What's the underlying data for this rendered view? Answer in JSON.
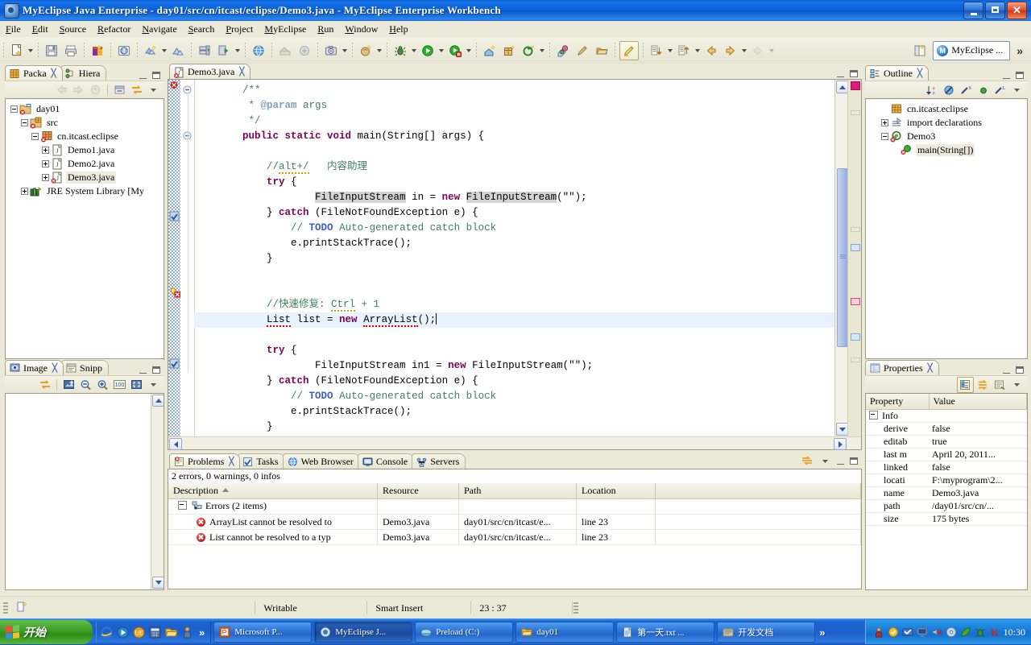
{
  "window": {
    "title": "MyEclipse Java Enterprise - day01/src/cn/itcast/eclipse/Demo3.java - MyEclipse Enterprise Workbench",
    "minimize_label": "Minimize",
    "maximize_label": "Maximize",
    "close_label": "Close"
  },
  "menubar": {
    "items": [
      {
        "label": "File"
      },
      {
        "label": "Edit"
      },
      {
        "label": "Source"
      },
      {
        "label": "Refactor"
      },
      {
        "label": "Navigate"
      },
      {
        "label": "Search"
      },
      {
        "label": "Project"
      },
      {
        "label": "MyEclipse"
      },
      {
        "label": "Run"
      },
      {
        "label": "Window"
      },
      {
        "label": "Help"
      }
    ]
  },
  "toolbar": {
    "perspective_label": "MyEclipse ...",
    "perspective_badge": "M",
    "overflow_label": "»",
    "buttons": [
      "new-wizard-icon",
      "save-icon",
      "print-icon",
      "myeclipse-icon",
      "web-20-icon",
      "new-deployment-icon",
      "deployment-icon",
      "run-server-icon",
      "run-server-menu-icon",
      "browser-icon",
      "import-icon",
      "export-icon",
      "snapshot-icon",
      "theme-icon",
      "debug-icon",
      "run-icon",
      "run-last-icon",
      "external-tools-icon",
      "new-class-icon",
      "new-package-icon",
      "open-type-icon",
      "search-icon",
      "pencil-icon",
      "folder-open-icon",
      "highlight-icon",
      "next-annotation-icon",
      "previous-annotation-icon",
      "back-icon",
      "forward-icon",
      "forward-disabled-icon"
    ]
  },
  "package_explorer": {
    "tabs": [
      {
        "label": "Packa",
        "icon": "package-explorer-icon",
        "active": true,
        "closable": true
      },
      {
        "label": "Hiera",
        "icon": "hierarchy-icon",
        "active": false,
        "closable": false
      }
    ],
    "toolbar_icons": [
      "back-icon",
      "forward-icon",
      "up-icon",
      "collapse-all-icon",
      "link-with-editor-icon",
      "view-menu-icon"
    ],
    "tree": [
      {
        "depth": 0,
        "expander": "minus",
        "icon": "project-error-icon",
        "label": "day01",
        "selected": false
      },
      {
        "depth": 1,
        "expander": "minus",
        "icon": "source-folder-error-icon",
        "label": "src",
        "selected": false
      },
      {
        "depth": 2,
        "expander": "minus",
        "icon": "package-error-icon",
        "label": "cn.itcast.eclipse",
        "selected": false
      },
      {
        "depth": 3,
        "expander": "plus",
        "icon": "java-file-icon",
        "label": "Demo1.java",
        "selected": false
      },
      {
        "depth": 3,
        "expander": "plus",
        "icon": "java-file-icon",
        "label": "Demo2.java",
        "selected": false
      },
      {
        "depth": 3,
        "expander": "plus",
        "icon": "java-file-error-icon",
        "label": "Demo3.java",
        "selected": true
      },
      {
        "depth": 1,
        "expander": "plus",
        "icon": "jre-library-icon",
        "label": "JRE System Library [My",
        "selected": false
      }
    ]
  },
  "image_view": {
    "tabs": [
      {
        "label": "Image",
        "icon": "image-icon",
        "active": true,
        "closable": true
      },
      {
        "label": "Snipp",
        "icon": "snippets-icon",
        "active": false,
        "closable": false
      }
    ],
    "toolbar_icons": [
      "link-icon",
      "edit-image-icon",
      "zoom-out-icon",
      "zoom-in-icon",
      "actual-size-icon",
      "fit-window-icon",
      "view-menu-icon"
    ]
  },
  "editor": {
    "tab": {
      "label": "Demo3.java",
      "icon": "java-file-error-icon",
      "closable": true
    },
    "lines": [
      {
        "n": 1,
        "indent": 2,
        "segs": [
          {
            "t": "/**",
            "c": "cmt"
          }
        ]
      },
      {
        "n": 2,
        "indent": 2,
        "segs": [
          {
            "t": " * ",
            "c": "cmt"
          },
          {
            "t": "@param",
            "c": "tag"
          },
          {
            "t": " args",
            "c": "cmt"
          }
        ]
      },
      {
        "n": 3,
        "indent": 2,
        "segs": [
          {
            "t": " */",
            "c": "cmt"
          }
        ]
      },
      {
        "n": 4,
        "indent": 2,
        "segs": [
          {
            "t": "public static void",
            "c": "kw"
          },
          {
            "t": " main(String[] args) {",
            "c": ""
          }
        ]
      },
      {
        "n": 5,
        "indent": 0,
        "segs": []
      },
      {
        "n": 6,
        "indent": 3,
        "segs": [
          {
            "t": "//",
            "c": "cmt"
          },
          {
            "t": "alt+/",
            "c": "cmt warnu"
          },
          {
            "t": "   内容助理",
            "c": "cmt"
          }
        ]
      },
      {
        "n": 7,
        "indent": 3,
        "segs": [
          {
            "t": "try",
            "c": "kw"
          },
          {
            "t": " {",
            "c": ""
          }
        ]
      },
      {
        "n": 8,
        "indent": 5,
        "segs": [
          {
            "t": "FileInputStream",
            "c": "occ"
          },
          {
            "t": " in = ",
            "c": ""
          },
          {
            "t": "new",
            "c": "kw"
          },
          {
            "t": " ",
            "c": ""
          },
          {
            "t": "FileInputStream",
            "c": "occ"
          },
          {
            "t": "(\"\");",
            "c": ""
          }
        ]
      },
      {
        "n": 9,
        "indent": 3,
        "segs": [
          {
            "t": "} ",
            "c": ""
          },
          {
            "t": "catch",
            "c": "kw"
          },
          {
            "t": " (FileNotFoundException e) {",
            "c": ""
          }
        ]
      },
      {
        "n": 10,
        "indent": 4,
        "segs": [
          {
            "t": "// ",
            "c": "cmt"
          },
          {
            "t": "TODO",
            "c": "todo"
          },
          {
            "t": " Auto-generated catch block",
            "c": "cmt"
          }
        ]
      },
      {
        "n": 11,
        "indent": 4,
        "segs": [
          {
            "t": "e.printStackTrace();",
            "c": ""
          }
        ]
      },
      {
        "n": 12,
        "indent": 3,
        "segs": [
          {
            "t": "}",
            "c": ""
          }
        ]
      },
      {
        "n": 13,
        "indent": 0,
        "segs": []
      },
      {
        "n": 14,
        "indent": 0,
        "segs": []
      },
      {
        "n": 15,
        "indent": 3,
        "segs": [
          {
            "t": "//快速修复: ",
            "c": "cmt"
          },
          {
            "t": "Ctrl",
            "c": "cmt warnu"
          },
          {
            "t": " + 1",
            "c": "cmt"
          }
        ]
      },
      {
        "n": 16,
        "indent": 3,
        "current": true,
        "segs": [
          {
            "t": "List",
            "c": "err"
          },
          {
            "t": " list = ",
            "c": ""
          },
          {
            "t": "new",
            "c": "kw"
          },
          {
            "t": " ",
            "c": ""
          },
          {
            "t": "ArrayList",
            "c": "err"
          },
          {
            "t": "();",
            "c": ""
          },
          {
            "t": "|",
            "c": "caret"
          }
        ]
      },
      {
        "n": 17,
        "indent": 3,
        "segs": [
          {
            "t": "try",
            "c": "kw"
          },
          {
            "t": " {",
            "c": ""
          }
        ]
      },
      {
        "n": 18,
        "indent": 5,
        "segs": [
          {
            "t": "FileInputStream in1 = ",
            "c": ""
          },
          {
            "t": "new",
            "c": "kw"
          },
          {
            "t": " FileInputStream(\"\");",
            "c": ""
          }
        ]
      },
      {
        "n": 19,
        "indent": 3,
        "segs": [
          {
            "t": "} ",
            "c": ""
          },
          {
            "t": "catch",
            "c": "kw"
          },
          {
            "t": " (FileNotFoundException e) {",
            "c": ""
          }
        ]
      },
      {
        "n": 20,
        "indent": 4,
        "segs": [
          {
            "t": "// ",
            "c": "cmt"
          },
          {
            "t": "TODO",
            "c": "todo"
          },
          {
            "t": " Auto-generated catch block",
            "c": "cmt"
          }
        ]
      },
      {
        "n": 21,
        "indent": 4,
        "segs": [
          {
            "t": "e.printStackTrace();",
            "c": ""
          }
        ]
      },
      {
        "n": 22,
        "indent": 3,
        "segs": [
          {
            "t": "}",
            "c": ""
          }
        ]
      },
      {
        "n": 23,
        "indent": 0,
        "segs": []
      },
      {
        "n": 24,
        "indent": 2,
        "segs": [
          {
            "t": "}",
            "c": ""
          }
        ]
      },
      {
        "n": 25,
        "indent": 0,
        "segs": []
      },
      {
        "n": 26,
        "indent": 0,
        "segs": [
          {
            "t": "}",
            "c": ""
          }
        ]
      }
    ]
  },
  "outline": {
    "tab": {
      "label": "Outline",
      "icon": "outline-icon",
      "closable": true
    },
    "toolbar_icons": [
      "sort-icon",
      "hide-fields-icon",
      "hide-static-icon",
      "hide-nonpublic-icon",
      "hide-local-icon",
      "view-menu-icon"
    ],
    "tree": [
      {
        "depth": 1,
        "expander": "none",
        "icon": "package-icon",
        "label": "cn.itcast.eclipse",
        "selected": false
      },
      {
        "depth": 1,
        "expander": "plus",
        "icon": "import-declarations-icon",
        "label": "import declarations",
        "selected": false
      },
      {
        "depth": 1,
        "expander": "minus",
        "icon": "class-error-icon",
        "label": "Demo3",
        "selected": false
      },
      {
        "depth": 2,
        "expander": "none",
        "icon": "method-static-error-icon",
        "label": "main(String[])",
        "selected": true
      }
    ]
  },
  "properties": {
    "tab": {
      "label": "Properties",
      "icon": "properties-icon",
      "closable": true
    },
    "toolbar_icons": [
      "show-categories-icon",
      "show-advanced-icon",
      "restore-default-icon",
      "view-menu-icon"
    ],
    "columns": [
      "Property",
      "Value"
    ],
    "group": "Info",
    "rows": [
      {
        "key": "derive",
        "value": "false"
      },
      {
        "key": "editab",
        "value": "true"
      },
      {
        "key": "last m",
        "value": "April 20, 2011..."
      },
      {
        "key": "linked",
        "value": "false"
      },
      {
        "key": "locati",
        "value": "F:\\myprogram\\2..."
      },
      {
        "key": "name",
        "value": "Demo3.java"
      },
      {
        "key": "path",
        "value": "/day01/src/cn/..."
      },
      {
        "key": "size",
        "value": "175  bytes"
      }
    ]
  },
  "problems": {
    "tabs": [
      {
        "label": "Problems",
        "icon": "problems-icon",
        "active": true,
        "closable": true
      },
      {
        "label": "Tasks",
        "icon": "tasks-icon",
        "active": false,
        "closable": false
      },
      {
        "label": "Web Browser",
        "icon": "web-browser-icon",
        "active": false,
        "closable": false
      },
      {
        "label": "Console",
        "icon": "console-icon",
        "active": false,
        "closable": false
      },
      {
        "label": "Servers",
        "icon": "servers-icon",
        "active": false,
        "closable": false
      }
    ],
    "summary": "2 errors, 0 warnings, 0 infos",
    "columns": [
      "Description",
      "Resource",
      "Path",
      "Location"
    ],
    "sorted_column": "Description",
    "group_row": "Errors (2 items)",
    "rows": [
      {
        "description": "ArrayList cannot be resolved to",
        "resource": "Demo3.java",
        "path": "day01/src/cn/itcast/e...",
        "location": "line 23"
      },
      {
        "description": "List cannot be resolved to a typ",
        "resource": "Demo3.java",
        "path": "day01/src/cn/itcast/e...",
        "location": "line 23"
      }
    ]
  },
  "statusbar": {
    "writable": "Writable",
    "insert_mode": "Smart Insert",
    "position": "23 : 37"
  },
  "taskbar": {
    "start_label": "开始",
    "quick_launch": [
      "internet-explorer-icon",
      "media-icon",
      "ultraedit-icon",
      "calculator-icon",
      "folder-icon",
      "person-icon"
    ],
    "quick_overflow": "»",
    "buttons": [
      {
        "label": "Microsoft P...",
        "icon": "powerpoint-icon",
        "active": false
      },
      {
        "label": "MyEclipse J...",
        "icon": "myeclipse-icon",
        "active": true
      },
      {
        "label": "Preload (C:)",
        "icon": "drive-icon",
        "active": false
      },
      {
        "label": "day01",
        "icon": "folder-icon",
        "active": false
      },
      {
        "label": "第一天.txt ...",
        "icon": "text-file-icon",
        "active": false
      },
      {
        "label": "开发文档",
        "icon": "folder-doc-icon",
        "active": false
      }
    ],
    "overflow": "»",
    "tray_icons": [
      "person-icon",
      "shield-icon",
      "network-icon",
      "monitor-icon",
      "volume-mute-icon",
      "disc-icon",
      "leaf-icon",
      "bug-icon",
      "kaspersky-icon"
    ],
    "clock": "10:30"
  }
}
